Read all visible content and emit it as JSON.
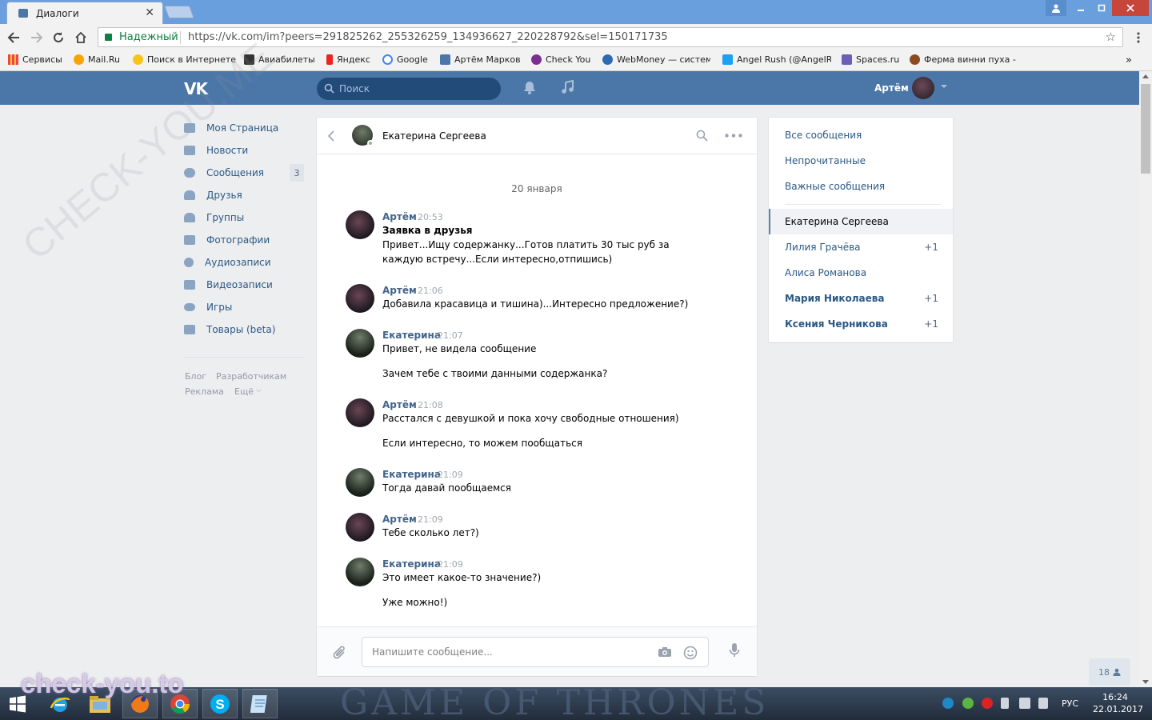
{
  "browser": {
    "tab_title": "Диалоги",
    "secure_label": "Надежный",
    "url": "https://vk.com/im?peers=291825262_255326259_134936627_220228792&sel=150171735",
    "bookmarks": [
      "Сервисы",
      "Mail.Ru",
      "Поиск в Интернете",
      "Авиабилеты",
      "Яндекс",
      "Google",
      "Артём Марков",
      "Check You",
      "WebMoney — систем",
      "Angel Rush (@AngelR",
      "Spaces.ru",
      "Ферма винни пуха -"
    ]
  },
  "header": {
    "logo": "VK",
    "search_placeholder": "Поиск",
    "user_name": "Артём"
  },
  "menu": {
    "items": [
      "Моя Страница",
      "Новости",
      "Сообщения",
      "Друзья",
      "Группы",
      "Фотографии",
      "Аудиозаписи",
      "Видеозаписи",
      "Игры",
      "Товары (beta)"
    ],
    "messages_badge": "3",
    "footer": [
      "Блог",
      "Разработчикам",
      "Реклама",
      "Ещё"
    ]
  },
  "chat": {
    "peer_name": "Екатерина Сергеева",
    "date": "20 января",
    "messages": [
      {
        "author": "Артём",
        "time": "20:53",
        "lines": [
          "Заявка в друзья",
          "Привет...Ищу содержанку...Готов платить 30 тыс руб за",
          "каждую встречу...Если интересно,отпишись)"
        ]
      },
      {
        "author": "Артём",
        "time": "21:06",
        "lines": [
          "Добавила красавица и тишина)...Интересно предложение?)"
        ]
      },
      {
        "author": "Екатерина",
        "time": "21:07",
        "lines": [
          "Привет, не видела сообщение",
          "Зачем тебе с твоими данными содержанка?"
        ]
      },
      {
        "author": "Артём",
        "time": "21:08",
        "lines": [
          "Расстался с девушкой и пока хочу свободные отношения)",
          "Если интересно, то можем пообщаться"
        ]
      },
      {
        "author": "Екатерина",
        "time": "21:09",
        "lines": [
          "Тогда давай пообщаемся"
        ]
      },
      {
        "author": "Артём",
        "time": "21:09",
        "lines": [
          "Тебе сколько лет?)"
        ]
      },
      {
        "author": "Екатерина",
        "time": "21:09",
        "lines": [
          "Это имеет какое-то значение?)",
          "Уже можно!)"
        ]
      }
    ],
    "composer_placeholder": "Напишите сообщение..."
  },
  "filters": [
    "Все сообщения",
    "Непрочитанные",
    "Важные сообщения"
  ],
  "conversations": [
    {
      "name": "Екатерина Сергеева",
      "count": ""
    },
    {
      "name": "Лилия Грачёва",
      "count": "+1"
    },
    {
      "name": "Алиса Романова",
      "count": ""
    },
    {
      "name": "Мария Николаева",
      "count": "+1"
    },
    {
      "name": "Ксения Черникова",
      "count": "+1"
    }
  ],
  "online_count": "18",
  "taskbar": {
    "background_text": "GAME OF THRONES",
    "lang": "РУС",
    "time": "16:24",
    "date": "22.01.2017"
  },
  "watermarks": {
    "diagonal": "CHECK-YOU.ME",
    "corner": "check-you.to"
  },
  "colors": {
    "vk_blue": "#4a76a8",
    "link": "#2a5885",
    "author": "#42648b"
  }
}
